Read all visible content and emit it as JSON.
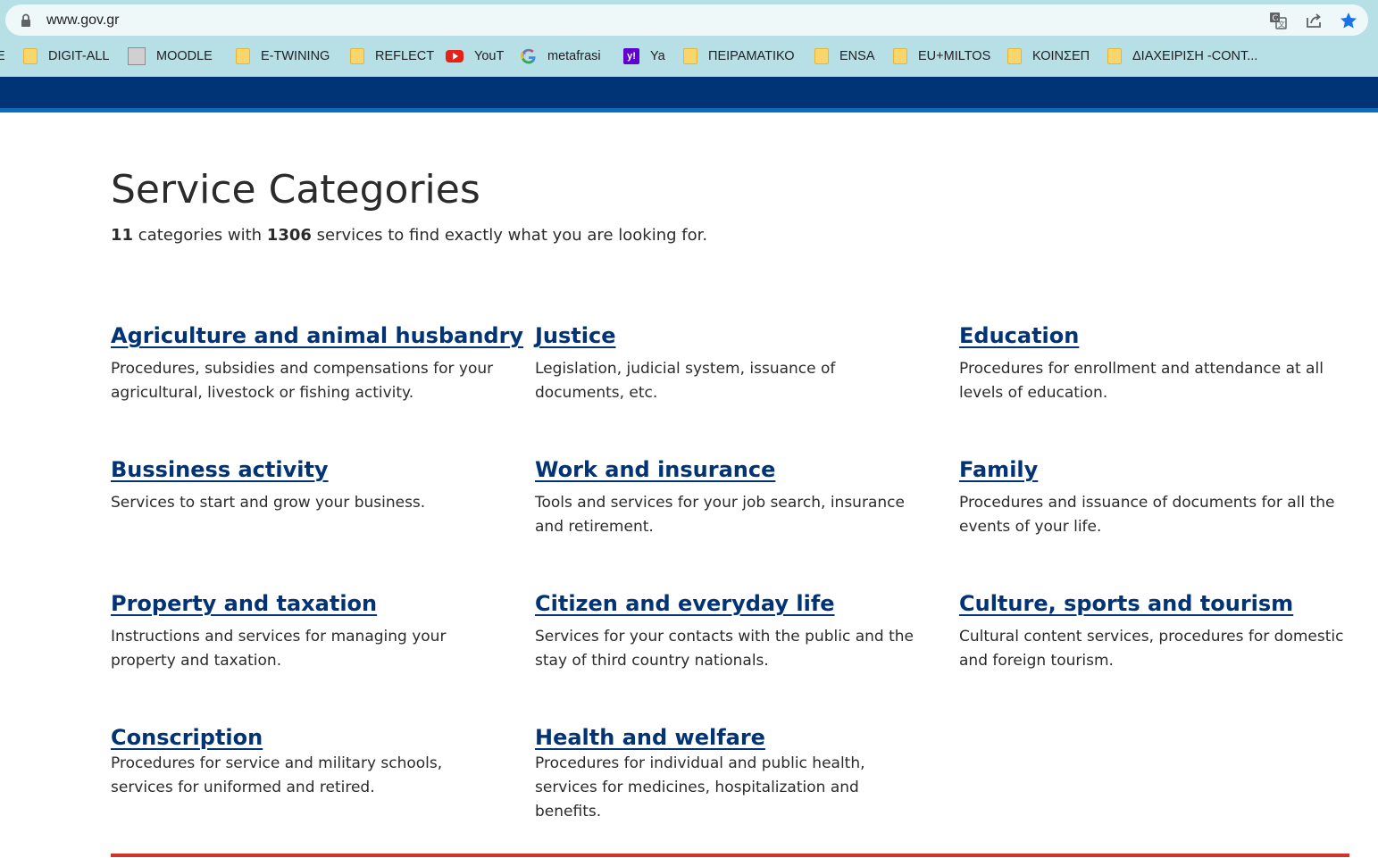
{
  "browser": {
    "url": "www.gov.gr",
    "bookmarks": [
      {
        "label": "E",
        "icon": "folder-icon"
      },
      {
        "label": "DIGIT-ALL",
        "icon": "folder-icon"
      },
      {
        "label": "MOODLE",
        "icon": "moodle-icon"
      },
      {
        "label": "E-TWINING",
        "icon": "folder-icon"
      },
      {
        "label": "REFLECT",
        "icon": "folder-icon"
      },
      {
        "label": "YouT",
        "icon": "youtube-icon"
      },
      {
        "label": "metafrasi",
        "icon": "google-icon"
      },
      {
        "label": "Ya",
        "icon": "yahoo-icon"
      },
      {
        "label": "ΠΕΙΡΑΜΑΤΙΚΟ",
        "icon": "folder-icon"
      },
      {
        "label": "ENSA",
        "icon": "folder-icon"
      },
      {
        "label": "EU+MILTOS",
        "icon": "folder-icon"
      },
      {
        "label": "ΚΟΙΝΣΕΠ",
        "icon": "folder-icon"
      },
      {
        "label": "ΔΙΑΧΕΙΡΙΣΗ -CONT...",
        "icon": "folder-icon"
      }
    ]
  },
  "colors": {
    "header_band": "#003476",
    "header_strip": "#046ec5",
    "link": "#003476",
    "bottom_rule": "#d0332b",
    "chrome": "#b7dfe6"
  },
  "page": {
    "title": "Service Categories",
    "summary": {
      "category_count": "11",
      "text_1": "categories with",
      "service_count": "1306",
      "text_2": "services to find exactly what you are looking for."
    },
    "categories": [
      {
        "title": "Agriculture and animal husbandry",
        "description": "Procedures, subsidies and compensations for your agricultural, livestock or fishing activity."
      },
      {
        "title": "Justice",
        "description": "Legislation, judicial system, issuance of documents, etc."
      },
      {
        "title": "Education",
        "description": "Procedures for enrollment and attendance at all levels of education."
      },
      {
        "title": "Bussiness activity",
        "description": "Services to start and grow your business."
      },
      {
        "title": "Work and insurance",
        "description": "Tools and services for your job search, insurance and retirement."
      },
      {
        "title": "Family",
        "description": "Procedures and issuance of documents for all the events of your life."
      },
      {
        "title": "Property and taxation",
        "description": "Instructions and services for managing your property and taxation."
      },
      {
        "title": "Citizen and everyday life",
        "description": "Services for your contacts with the public and the stay of third country nationals."
      },
      {
        "title": "Culture, sports and tourism",
        "description": "Cultural content services, procedures for domestic and foreign tourism."
      },
      {
        "title": "Conscription",
        "description": "Procedures for service and military schools, services for uniformed and retired."
      },
      {
        "title": "Health and welfare",
        "description": "Procedures for individual and public health, services for medicines, hospitalization and benefits."
      }
    ]
  }
}
